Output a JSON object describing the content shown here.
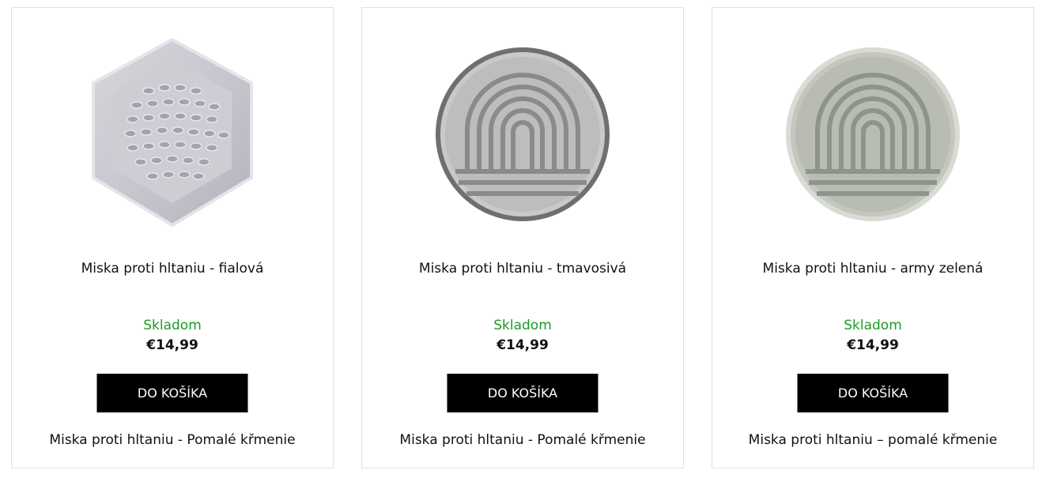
{
  "products": [
    {
      "title": "Miska proti hltaniu - fialová",
      "stock": "Skladom",
      "price": "€14,99",
      "button_label": "DO KOŠÍKA",
      "subtitle": "Miska proti hltaniu - Pomalé křmenie",
      "image_icon": "hexagon-slow-feeder-bowl-icon"
    },
    {
      "title": "Miska proti hltaniu - tmavosivá",
      "stock": "Skladom",
      "price": "€14,99",
      "button_label": "DO KOŠÍKA",
      "subtitle": "Miska proti hltaniu - Pomalé křmenie",
      "image_icon": "round-rainbow-slow-feeder-bowl-icon"
    },
    {
      "title": "Miska proti hltaniu - army zelená",
      "stock": "Skladom",
      "price": "€14,99",
      "button_label": "DO KOŠÍKA",
      "subtitle": "Miska proti hltaniu – pomalé křmenie",
      "image_icon": "round-rainbow-slow-feeder-bowl-icon"
    }
  ],
  "colors": {
    "stock_green": "#1e9a27",
    "button_bg": "#000000",
    "button_text": "#ffffff",
    "card_border": "#e2e2e2"
  }
}
